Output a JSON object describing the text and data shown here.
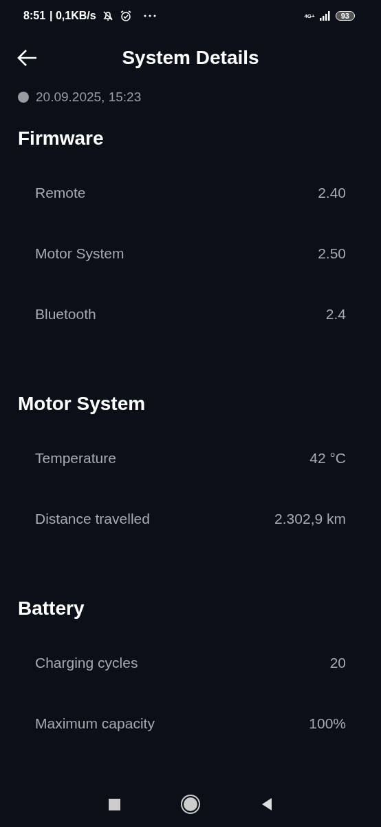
{
  "status_bar": {
    "time": "8:51",
    "speed": "| 0,1KB/s",
    "network": "4G+",
    "battery": "93"
  },
  "header": {
    "title": "System Details"
  },
  "connection": {
    "online": false,
    "text": "20.09.2025, 15:23"
  },
  "sections": [
    {
      "title": "Firmware",
      "rows": [
        {
          "label": "Remote",
          "value": "2.40"
        },
        {
          "label": "Motor System",
          "value": "2.50"
        },
        {
          "label": "Bluetooth",
          "value": "2.4"
        }
      ]
    },
    {
      "title": "Motor System",
      "rows": [
        {
          "label": "Temperature",
          "value": "42 °C"
        },
        {
          "label": "Distance travelled",
          "value": "2.302,9 km"
        }
      ]
    },
    {
      "title": "Battery",
      "rows": [
        {
          "label": "Charging cycles",
          "value": "20"
        },
        {
          "label": "Maximum capacity",
          "value": "100%"
        }
      ]
    }
  ]
}
